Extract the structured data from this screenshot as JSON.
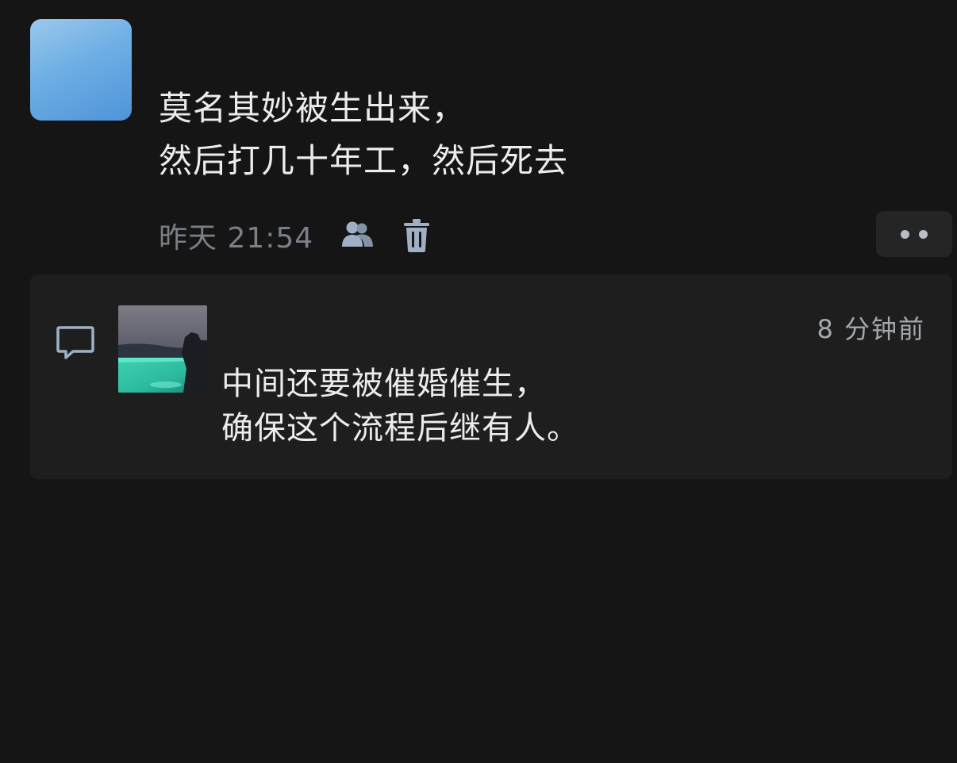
{
  "post": {
    "avatar": {
      "colors": {
        "top": "#9bc8ee",
        "bottom": "#4e94d9"
      }
    },
    "text_lines": [
      "莫名其妙被生出来，",
      "然后打几十年工，然后死去"
    ],
    "time": "昨天 21:54",
    "icons": {
      "privacy": "people-icon",
      "delete": "trash-icon",
      "more": "more-dots-icon"
    }
  },
  "comment": {
    "icon": "comment-icon",
    "avatar_description_icon": "landscape-pool-avatar",
    "time": "8 分钟前",
    "text_lines": [
      "中间还要被催婚催生，",
      "确保这个流程后继有人。"
    ]
  },
  "colors": {
    "background": "#151515",
    "comment_background": "#1e1e1e",
    "text_primary": "#ececec",
    "text_secondary": "#7a7f88",
    "icon": "#9fb0c6"
  }
}
